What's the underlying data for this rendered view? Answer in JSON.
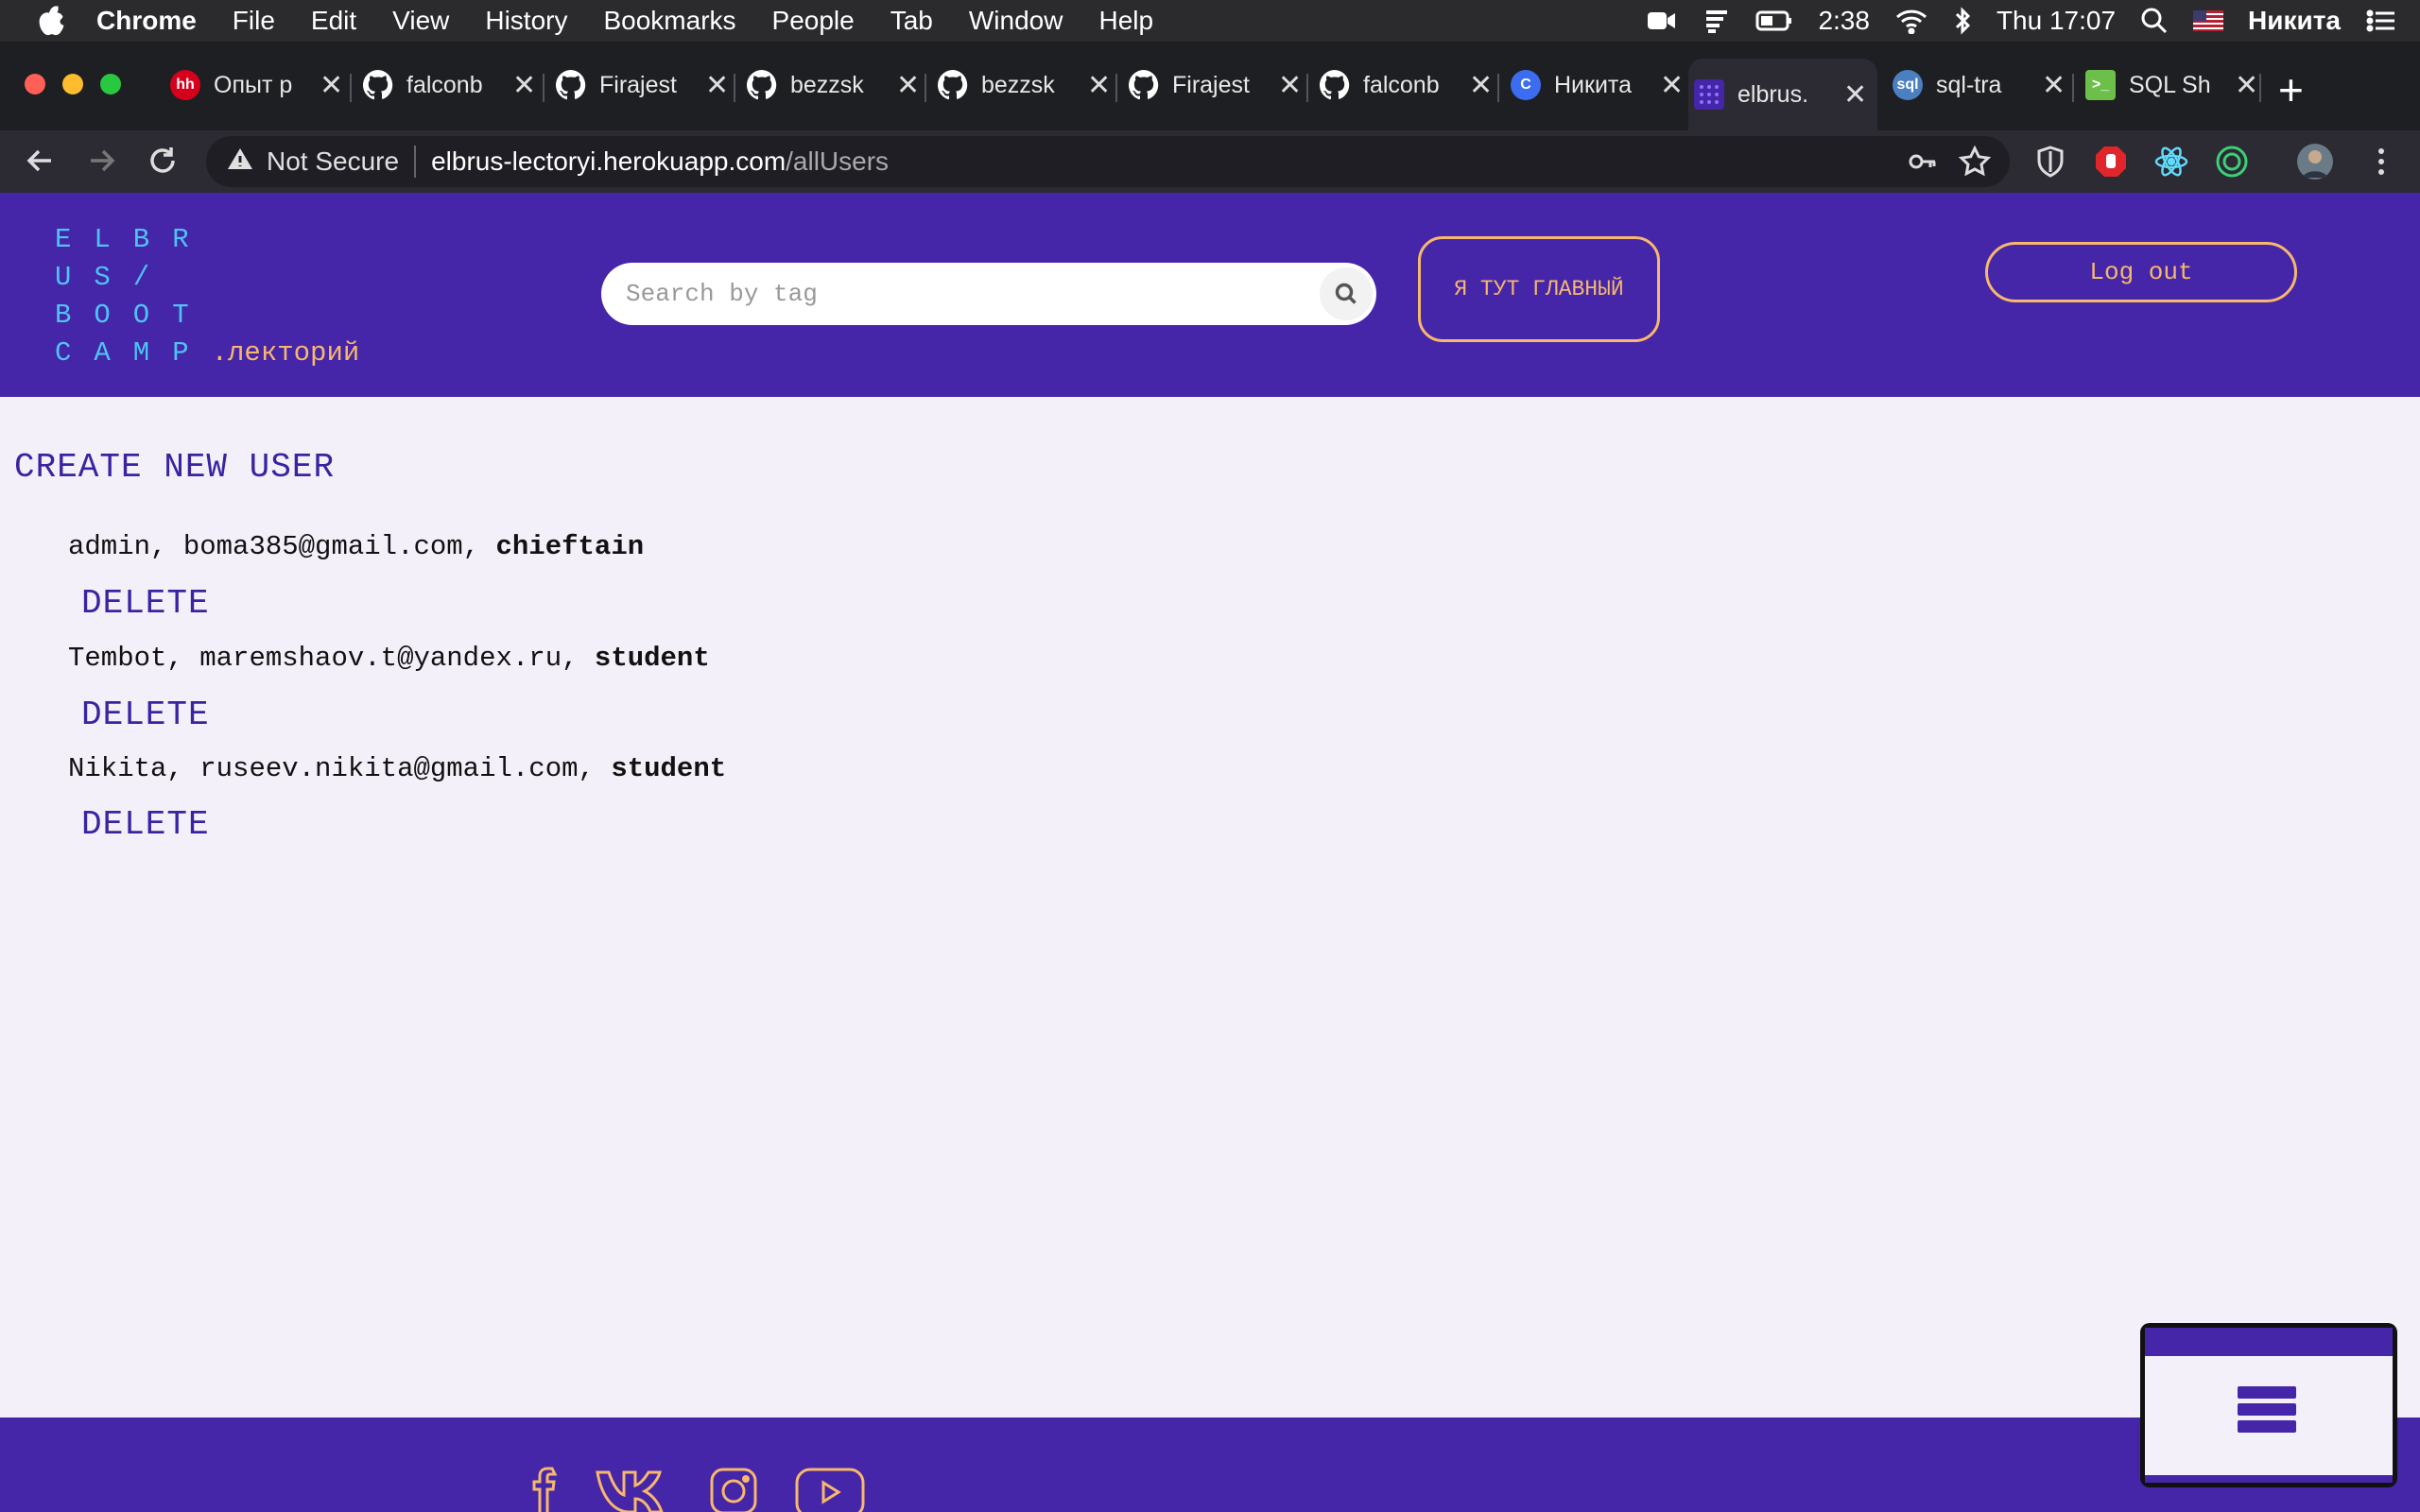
{
  "menubar": {
    "app_name": "Chrome",
    "items": [
      "File",
      "Edit",
      "View",
      "History",
      "Bookmarks",
      "People",
      "Tab",
      "Window",
      "Help"
    ],
    "battery_time": "2:38",
    "clock": "Thu 17:07",
    "user_name": "Никита"
  },
  "tabs": [
    {
      "title": "Опыт р",
      "icon": "hh-icon",
      "color": "#d6001c",
      "badge": "hh"
    },
    {
      "title": "falconb",
      "icon": "github-icon"
    },
    {
      "title": "Firajest",
      "icon": "github-icon"
    },
    {
      "title": "bezzsk",
      "icon": "github-icon"
    },
    {
      "title": "bezzsk",
      "icon": "github-icon"
    },
    {
      "title": "Firajest",
      "icon": "github-icon"
    },
    {
      "title": "falconb",
      "icon": "github-icon"
    },
    {
      "title": "Никита",
      "icon": "c-icon",
      "color": "#3c6df0",
      "badge": "C"
    },
    {
      "title": "elbrus.",
      "icon": "elbrus-grid-icon",
      "color": "#4525a8",
      "active": true
    },
    {
      "title": "sql-tra",
      "icon": "sql-icon",
      "color": "#4a7fc1"
    },
    {
      "title": "SQL Sh",
      "icon": "sql-sh-icon",
      "color": "#6cc04a"
    }
  ],
  "address_bar": {
    "security_label": "Not Secure",
    "host": "elbrus-lectoryi.herokuapp.com",
    "path": "/allUsers"
  },
  "header": {
    "logo_lines": [
      "ELBR",
      "US/",
      "BOOT",
      "CAMP"
    ],
    "logo_suffix": ".лекторий",
    "search_placeholder": "Search by tag",
    "role_button": "Я ТУТ ГЛАВНЫЙ",
    "logout_button": "Log out"
  },
  "main": {
    "create_link": "CREATE NEW USER",
    "delete_label": "DELETE",
    "users": [
      {
        "name": "admin",
        "email": "boma385@gmail.com",
        "role": "chieftain"
      },
      {
        "name": "Tembot",
        "email": "maremshaov.t@yandex.ru",
        "role": "student"
      },
      {
        "name": "Nikita",
        "email": "ruseev.nikita@gmail.com",
        "role": "student"
      }
    ]
  },
  "footer": {
    "social": [
      "facebook-icon",
      "vk-icon",
      "instagram-icon",
      "youtube-icon"
    ]
  },
  "colors": {
    "brand_purple": "#4525a8",
    "accent_orange": "#f7b86d",
    "logo_blue": "#4ec3f4",
    "link_purple": "#3b23a0"
  }
}
